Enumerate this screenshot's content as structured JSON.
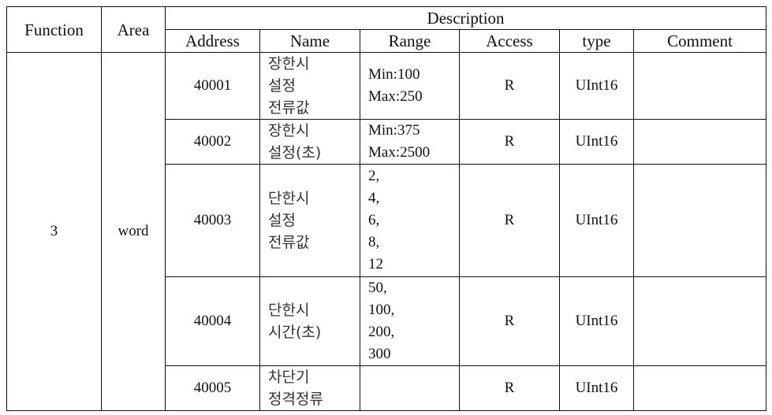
{
  "table": {
    "headers": {
      "function": "Function",
      "area": "Area",
      "description": "Description",
      "address": "Address",
      "name": "Name",
      "range": "Range",
      "access": "Access",
      "type": "type",
      "comment": "Comment"
    },
    "function_value": "3",
    "area_value": "word",
    "rows": [
      {
        "address": "40001",
        "name": [
          "장한시",
          "설정",
          "전류값"
        ],
        "range": [
          "Min:100",
          "Max:250"
        ],
        "access": "R",
        "type": "UInt16",
        "comment": ""
      },
      {
        "address": "40002",
        "name": [
          "장한시",
          "설정(초)"
        ],
        "range": [
          "Min:375",
          "Max:2500"
        ],
        "access": "R",
        "type": "UInt16",
        "comment": ""
      },
      {
        "address": "40003",
        "name": [
          "단한시",
          "설정",
          "전류값"
        ],
        "range": [
          "2,",
          "4,",
          "6,",
          "8,",
          "12"
        ],
        "access": "R",
        "type": "UInt16",
        "comment": ""
      },
      {
        "address": "40004",
        "name": [
          "단한시",
          "시간(초)"
        ],
        "range": [
          "50,",
          "100,",
          "200,",
          "300"
        ],
        "access": "R",
        "type": "UInt16",
        "comment": ""
      },
      {
        "address": "40005",
        "name": [
          "차단기",
          "정격정류"
        ],
        "range": [],
        "access": "R",
        "type": "UInt16",
        "comment": ""
      }
    ]
  }
}
